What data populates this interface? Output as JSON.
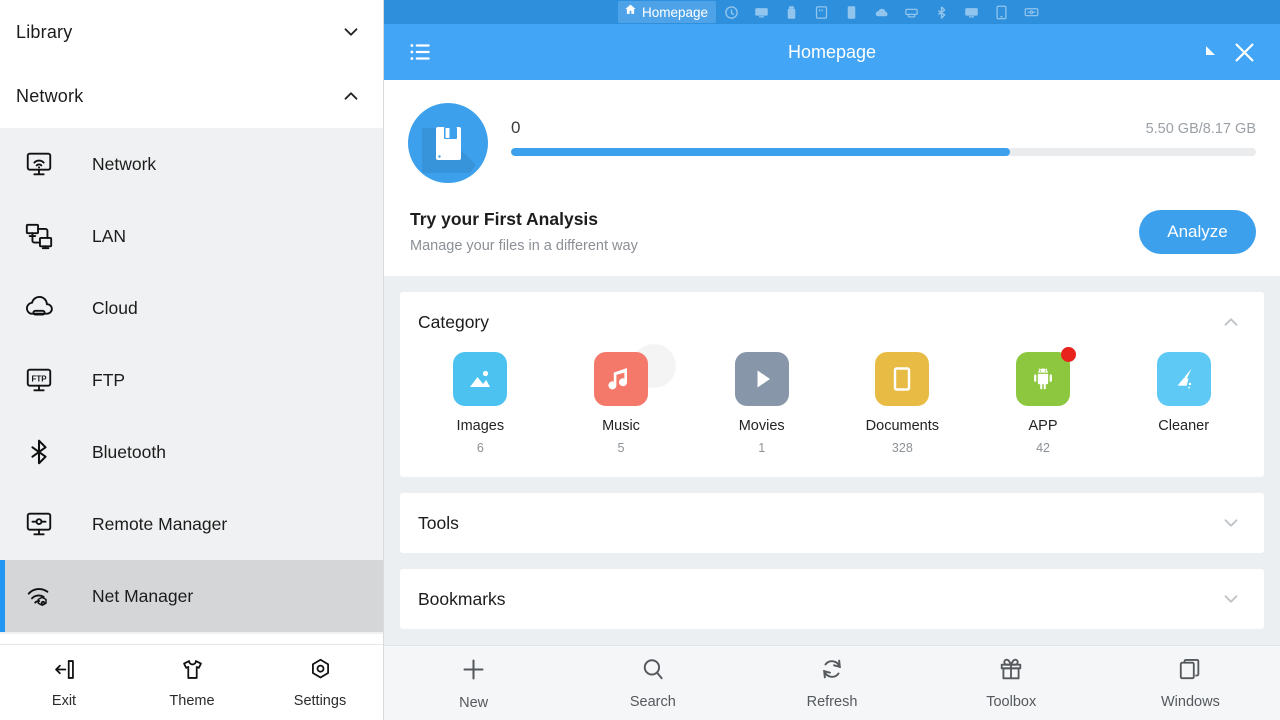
{
  "sidebar": {
    "sections": [
      {
        "label": "Library",
        "expanded": false,
        "chevron": "chevron-down-icon"
      },
      {
        "label": "Network",
        "expanded": true,
        "chevron": "chevron-up-icon"
      }
    ],
    "items": [
      {
        "label": "Network",
        "icon": "monitor-wifi-icon",
        "selected": false
      },
      {
        "label": "LAN",
        "icon": "lan-icon",
        "selected": false
      },
      {
        "label": "Cloud",
        "icon": "cloud-icon",
        "selected": false
      },
      {
        "label": "FTP",
        "icon": "ftp-icon",
        "selected": false
      },
      {
        "label": "Bluetooth",
        "icon": "bluetooth-icon",
        "selected": false
      },
      {
        "label": "Remote Manager",
        "icon": "remote-manager-icon",
        "selected": false
      },
      {
        "label": "Net Manager",
        "icon": "net-manager-icon",
        "selected": true
      }
    ],
    "bottom": [
      {
        "label": "Exit",
        "icon": "exit-icon"
      },
      {
        "label": "Theme",
        "icon": "tshirt-icon"
      },
      {
        "label": "Settings",
        "icon": "gear-icon"
      }
    ]
  },
  "tabstrip": {
    "active_tab": {
      "label": "Homepage",
      "icon": "home-icon"
    },
    "icon_tabs": [
      {
        "icon": "compass-icon"
      },
      {
        "icon": "device-screen-icon"
      },
      {
        "icon": "usb-drive-icon"
      },
      {
        "icon": "sdcard-icon"
      },
      {
        "icon": "phone-icon"
      },
      {
        "icon": "cloud-icon"
      },
      {
        "icon": "network-icon"
      },
      {
        "icon": "bluetooth-icon"
      },
      {
        "icon": "device-screen-icon"
      },
      {
        "icon": "tablet-icon"
      },
      {
        "icon": "remote-icon"
      }
    ]
  },
  "header": {
    "menu_icon": "list-icon",
    "title": "Homepage",
    "resize_icon": "resize-handle-icon",
    "close_icon": "close-icon"
  },
  "storage": {
    "disk_icon": "floppy-disk-icon",
    "label": "0",
    "used": "5.50 GB",
    "separator": "/",
    "total": "8.17 GB",
    "size_text": "5.50 GB/8.17 GB",
    "percent": 67,
    "analysis_title": "Try your First Analysis",
    "analysis_sub": "Manage your files in a different way",
    "analyze_label": "Analyze",
    "accent_color": "#3ca0ec"
  },
  "panels": [
    {
      "title": "Category",
      "expanded": true,
      "chevron": "chevron-up-icon"
    },
    {
      "title": "Tools",
      "expanded": false,
      "chevron": "chevron-down-icon"
    },
    {
      "title": "Bookmarks",
      "expanded": false,
      "chevron": "chevron-down-icon"
    }
  ],
  "category": {
    "title": "Category",
    "items": [
      {
        "label": "Images",
        "count": "6",
        "icon": "image-icon",
        "color": "#4cc2f1",
        "badge": false
      },
      {
        "label": "Music",
        "count": "5",
        "icon": "music-icon",
        "color": "#f4796b",
        "badge": false
      },
      {
        "label": "Movies",
        "count": "1",
        "icon": "play-icon",
        "color": "#8796a8",
        "badge": false
      },
      {
        "label": "Documents",
        "count": "328",
        "icon": "document-icon",
        "color": "#e8bc44",
        "badge": false
      },
      {
        "label": "APP",
        "count": "42",
        "icon": "android-icon",
        "color": "#8dc63f",
        "badge": true
      },
      {
        "label": "Cleaner",
        "count": "",
        "icon": "broom-icon",
        "color": "#5ec9f5",
        "badge": false
      }
    ]
  },
  "bottomnav": [
    {
      "label": "New",
      "icon": "plus-icon"
    },
    {
      "label": "Search",
      "icon": "search-icon"
    },
    {
      "label": "Refresh",
      "icon": "refresh-icon"
    },
    {
      "label": "Toolbox",
      "icon": "gift-icon"
    },
    {
      "label": "Windows",
      "icon": "windows-stack-icon"
    }
  ]
}
